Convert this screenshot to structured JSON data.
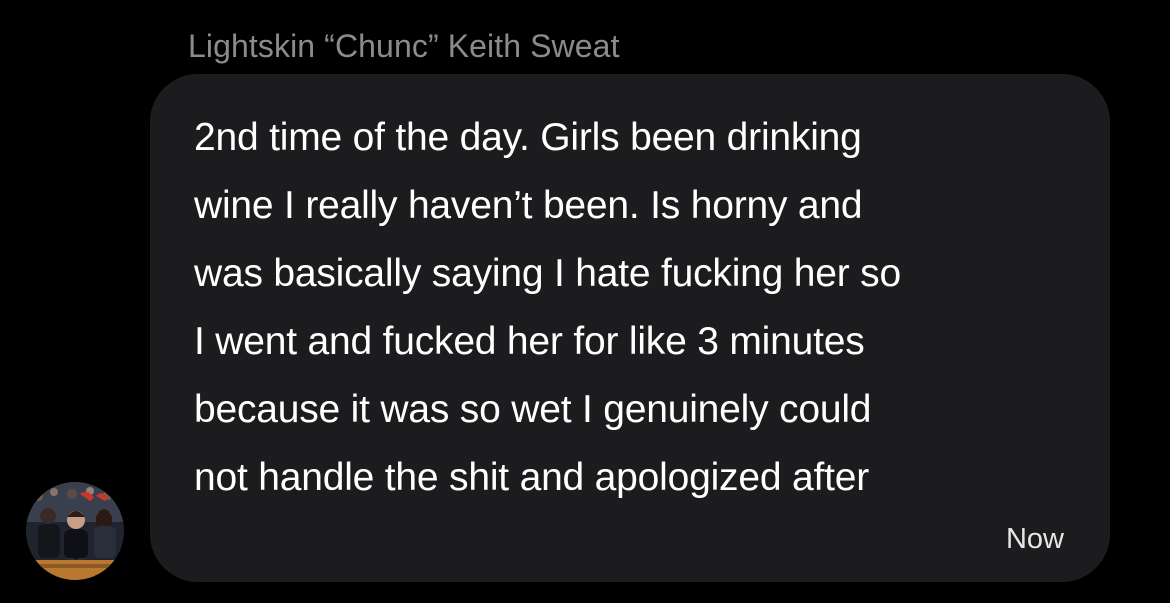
{
  "message": {
    "sender_name": "Lightskin “Chunc” Keith Sweat",
    "avatar_icon": "crowd-photo-avatar",
    "body_lines": [
      "2nd time of the day. Girls been drinking",
      "wine I really haven’t been. Is horny and",
      "was basically saying I hate fucking her so",
      "I went and fucked her for like 3 minutes",
      "because it was so wet I genuinely could",
      "not handle the shit and apologized after"
    ],
    "timestamp": "Now"
  },
  "colors": {
    "background": "#000000",
    "bubble": "#1c1c1e",
    "text": "#ffffff",
    "sender_name": "#8b8b8f"
  }
}
